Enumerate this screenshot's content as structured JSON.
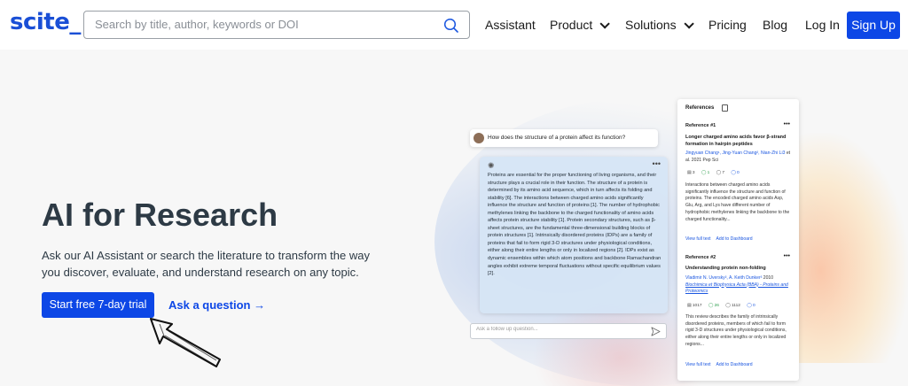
{
  "header": {
    "logo": "scite_",
    "search_placeholder": "Search by title, author, keywords or DOI",
    "nav": {
      "assistant": "Assistant",
      "product": "Product",
      "solutions": "Solutions",
      "pricing": "Pricing",
      "blog": "Blog",
      "login": "Log In",
      "signup": "Sign Up"
    }
  },
  "hero": {
    "title": "AI for Research",
    "description": "Ask our AI Assistant or search the literature to transform the way you discover, evaluate, and understand research on any topic.",
    "cta": "Start free 7-day trial",
    "ask_link": "Ask a question →"
  },
  "chat": {
    "question": "How does the structure of a protein affect its function?",
    "answer": "Proteins are essential for the proper functioning of living organisms, and their structure plays a crucial role in their function. The structure of a protein is determined by its amino acid sequence, which in turn affects its folding and stability [6]. The interactions between charged amino acids significantly influence the structure and function of proteins [1]. The number of hydrophobic methylenes linking the backbone to the charged functionality of amino acids affects protein structure stability [1]. Protein secondary structures, such as β-sheet structures, are the fundamental three-dimensional building blocks of protein structures [1]. Intrinsically disordered proteins (IDPs) are a family of proteins that fail to form rigid 3-D structures under physiological conditions, either along their entire lengths or only in localized regions [2]. IDPs exist as dynamic ensembles within which atom positions and backbone Ramachandran angles exhibit extreme temporal fluctuations without specific equilibrium values [2].",
    "followup_placeholder": "Ask a follow up question..."
  },
  "references": {
    "heading": "References",
    "items": [
      {
        "label": "Reference #1",
        "title": "Longer charged amino acids favor β-strand formation in hairpin peptides",
        "authors": "Jingyuan Chang¹, Jing-Yuan Chang², Nian-Zhi Li3",
        "meta": " et al. 2021 Pep Sci",
        "badges": [
          "3",
          "1",
          "7",
          "0"
        ],
        "snippet": "Interactions between charged amino acids significantly influence the structure and function of proteins. The encoded charged amino acids Asp, Glu, Arg, and Lys have different number of hydrophobic methylenes linking the backbone to the charged functionality...",
        "view": "View full text",
        "add": "Add to Dashboard"
      },
      {
        "label": "Reference #2",
        "title": "Understanding protein non-folding",
        "authors": "Vladimir N. Uversky², A. Keith Dunker³",
        "meta": " 2010",
        "journal": "Biochimica et Biophysica Acta (BBA) - Proteins and Proteomics",
        "badges": [
          "1017",
          "26",
          "1112",
          "0"
        ],
        "snippet": "This review describes the family of intrinsically disordered proteins, members of which fail to form rigid 3-D structures under physiological conditions, either along their entire lengths or only in localized regions...",
        "view": "View full text",
        "add": "Add to Dashboard"
      }
    ]
  }
}
